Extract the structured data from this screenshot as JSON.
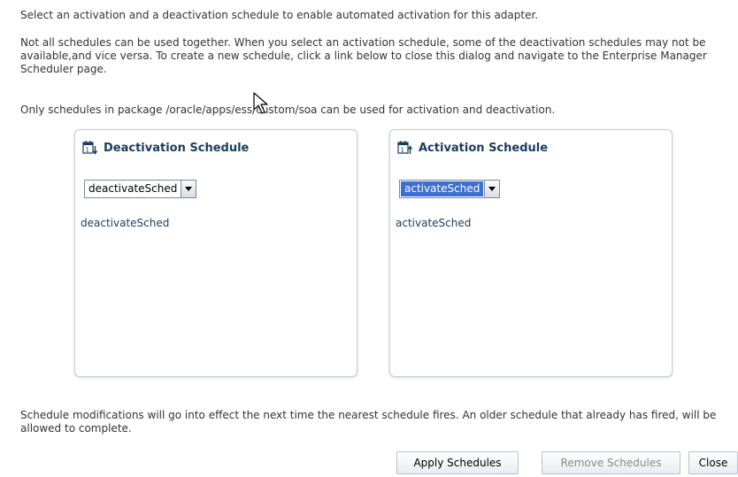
{
  "instructions": {
    "intro": "Select an activation and a deactivation schedule to enable automated activation for this adapter.",
    "compatibility_note": "Not all schedules can be used together. When you select an activation schedule, some of the deactivation schedules may not be available,and vice versa. To create a new schedule, click a link below to close this dialog and navigate to the Enterprise Manager Scheduler page.",
    "package_note": "Only schedules in package /oracle/apps/ess/custom/soa can be used for activation and deactivation.",
    "footer_note": "Schedule modifications will go into effect the next time the nearest schedule fires. An older schedule that already has fired, will be allowed to complete."
  },
  "deactivation": {
    "title": "Deactivation Schedule",
    "selected": "deactivateSched",
    "link": "deactivateSched"
  },
  "activation": {
    "title": "Activation Schedule",
    "selected": "activateSched",
    "link": "activateSched"
  },
  "buttons": {
    "apply": "Apply Schedules",
    "remove": "Remove Schedules",
    "close": "Close"
  },
  "icons": {
    "deactivation": "calendar-down-icon",
    "activation": "calendar-up-icon",
    "dropdown": "chevron-down-icon"
  },
  "colors": {
    "title": "#1b3c5e",
    "selection_highlight": "#3b6fd4",
    "disabled_text": "#8a8a8a"
  }
}
